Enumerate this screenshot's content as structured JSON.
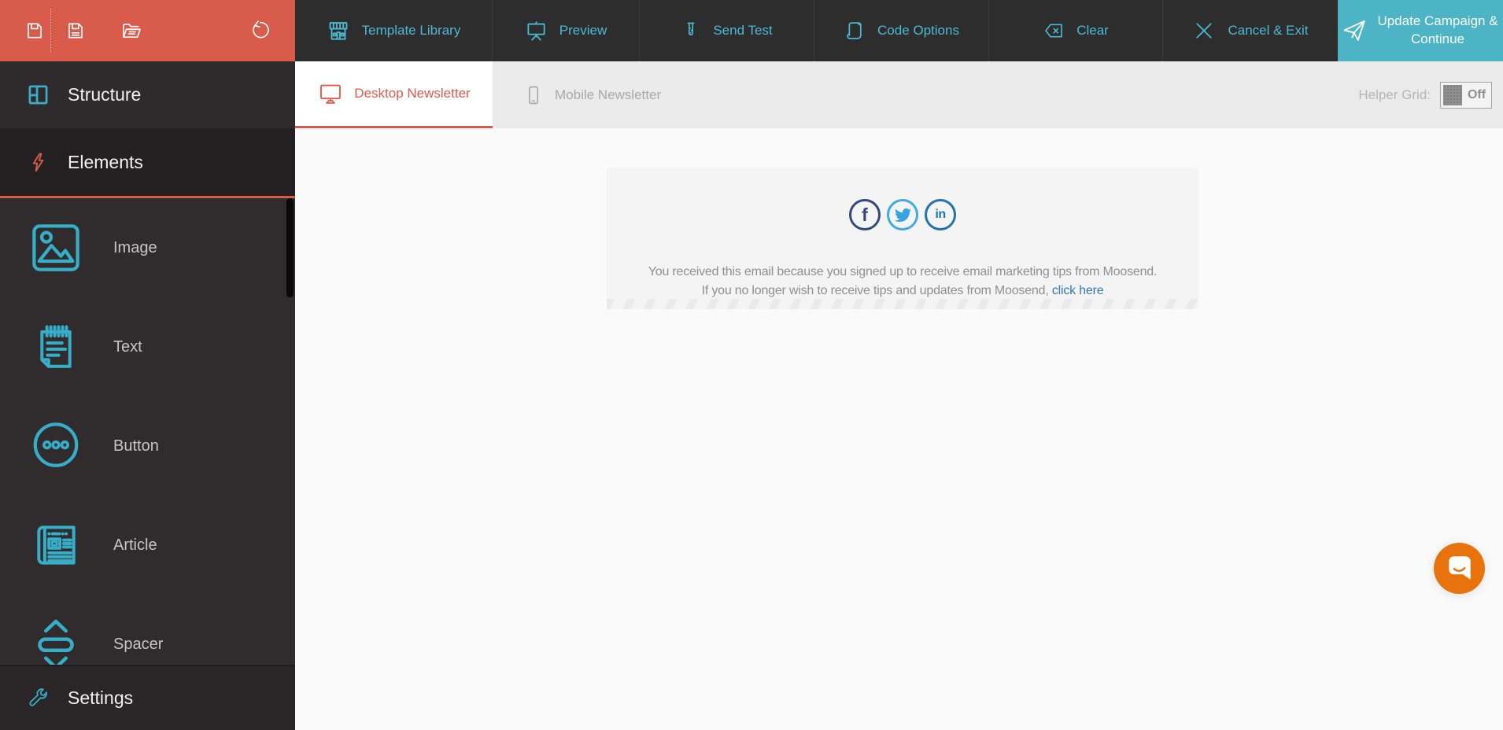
{
  "toolbar": {
    "file_actions": [
      {
        "icon": "save-icon"
      },
      {
        "icon": "save-as-icon"
      },
      {
        "icon": "open-folder-icon"
      },
      {
        "icon": "undo-icon"
      }
    ],
    "buttons": [
      {
        "label": "Template Library",
        "icon": "storefront-icon"
      },
      {
        "label": "Preview",
        "icon": "presentation-icon"
      },
      {
        "label": "Send Test",
        "icon": "test-tube-icon"
      },
      {
        "label": "Code Options",
        "icon": "scroll-icon"
      },
      {
        "label": "Clear",
        "icon": "clear-backspace-icon"
      },
      {
        "label": "Cancel & Exit",
        "icon": "x-icon"
      },
      {
        "label": "Update Campaign & Continue",
        "icon": "paper-plane-icon"
      }
    ]
  },
  "tabbar": {
    "tabs": [
      {
        "label": "Desktop Newsletter",
        "icon": "desktop-monitor-icon",
        "active": true
      },
      {
        "label": "Mobile Newsletter",
        "icon": "smartphone-icon",
        "active": false
      }
    ],
    "helper_grid": {
      "label": "Helper Grid:",
      "state": "Off"
    }
  },
  "sidebar": {
    "structure": {
      "label": "Structure",
      "icon": "layout-panes-icon"
    },
    "elements": {
      "label": "Elements",
      "icon": "lightning-icon",
      "items": [
        {
          "label": "Image",
          "icon": "image-icon"
        },
        {
          "label": "Text",
          "icon": "notepad-icon"
        },
        {
          "label": "Button",
          "icon": "circle-dots-icon"
        },
        {
          "label": "Article",
          "icon": "newspaper-icon"
        },
        {
          "label": "Spacer",
          "icon": "spacer-arrows-icon"
        }
      ]
    },
    "settings": {
      "label": "Settings",
      "icon": "wrench-icon"
    }
  },
  "canvas": {
    "social_icons": [
      {
        "name": "facebook",
        "glyph": "f"
      },
      {
        "name": "twitter",
        "glyph": "twitter-bird"
      },
      {
        "name": "linkedin",
        "glyph": "in"
      }
    ],
    "footer": {
      "line1": "You received this email because you signed up to receive email marketing tips from Moosend.",
      "line2_prefix": "If you no longer wish to receive tips and updates from Moosend, ",
      "link_text": "click here"
    },
    "chat_launcher_icon": "chat-bubble-smile-icon"
  },
  "colors": {
    "toolbar_red": "#d85b4c",
    "toolbar_dark": "#2d2d2d",
    "accent_cyan_text": "#4cb9d2",
    "accent_cyan_button": "#4db4c6",
    "tab_active_red": "#e05a4d",
    "sidebar_icon_teal": "#36aec8",
    "facebook_blue": "#33487e",
    "twitter_blue": "#41abe2",
    "linkedin_blue": "#2273b2",
    "chat_orange": "#e8720c",
    "canvas_bg": "#fafafa",
    "email_block_bg": "#f4f4f4"
  }
}
